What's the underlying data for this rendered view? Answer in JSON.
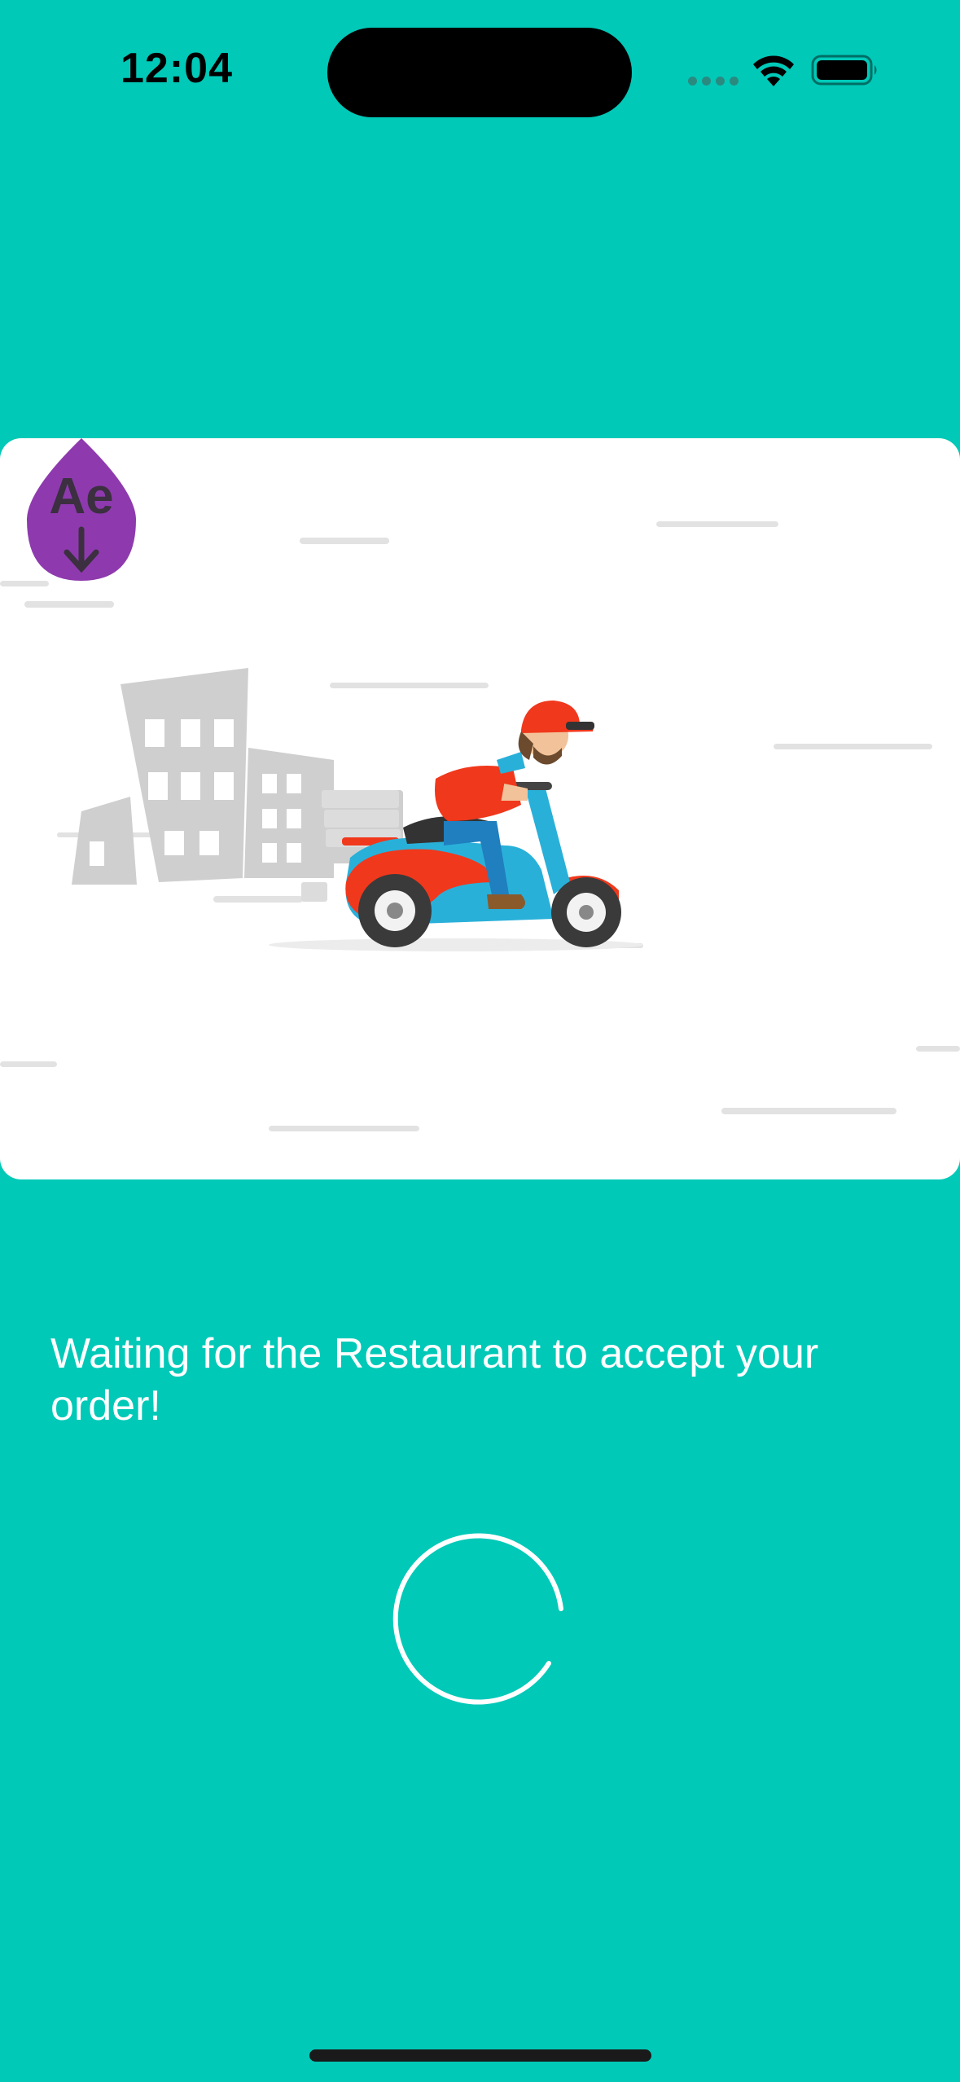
{
  "status_bar": {
    "time": "12:04",
    "wifi": "wifi-icon",
    "battery": "battery-icon",
    "signal": "cellular-dots-icon"
  },
  "animation": {
    "badge_text": "Ae",
    "badge_color": "#8E3AAE",
    "illustration": "delivery-scooter-illustration"
  },
  "message": "Waiting for the Restaurant to accept your order!",
  "spinner": "loading-spinner",
  "colors": {
    "background": "#00C9B8",
    "card": "#FFFFFF",
    "text": "#FFFFFF"
  }
}
